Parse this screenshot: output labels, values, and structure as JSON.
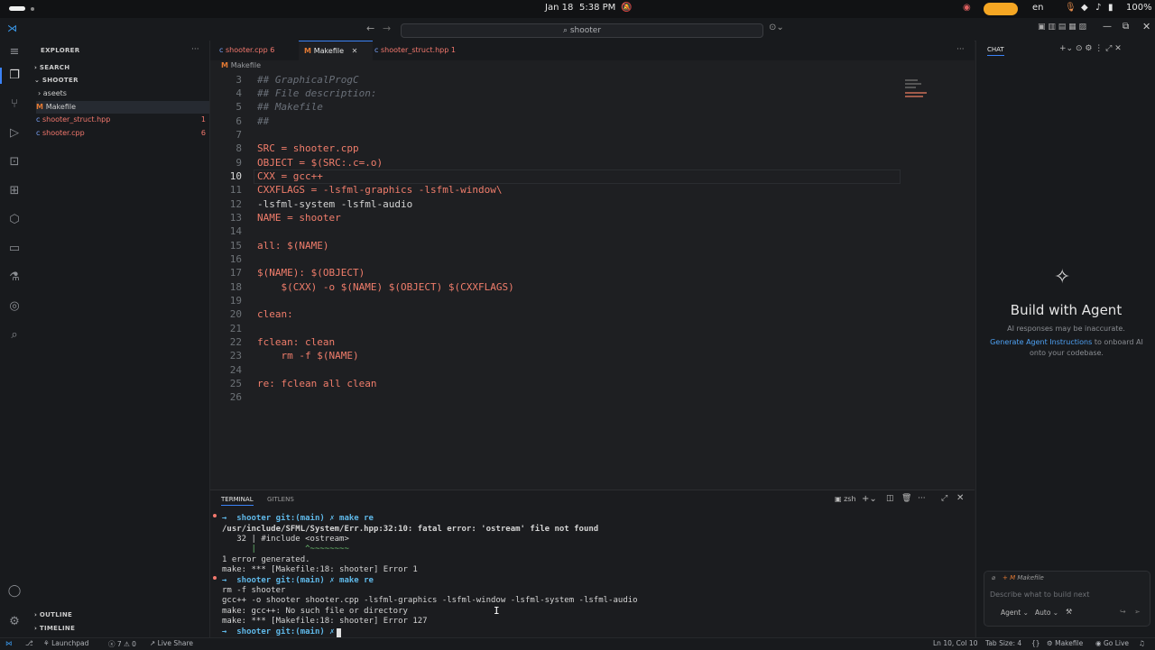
{
  "system": {
    "date": "Jan 18",
    "time": "5:38 PM",
    "lang": "en",
    "battery": "100%"
  },
  "window": {
    "search_text": "shooter"
  },
  "sidebar": {
    "title": "EXPLORER",
    "search_section": "SEARCH",
    "project": "SHOOTER",
    "items": [
      {
        "label": "aseets",
        "icon": "folder-chevron-icon"
      },
      {
        "label": "Makefile",
        "icon": "makefile-icon"
      },
      {
        "label": "shooter_struct.hpp",
        "badge": "1"
      },
      {
        "label": "shooter.cpp",
        "badge": "6"
      }
    ],
    "outline": "OUTLINE",
    "timeline": "TIMELINE"
  },
  "tabs": [
    {
      "label": "shooter.cpp",
      "badge": "6"
    },
    {
      "label": "Makefile"
    },
    {
      "label": "shooter_struct.hpp",
      "badge": "1"
    }
  ],
  "breadcrumb": "Makefile",
  "editor": {
    "line_numbers": [
      "3",
      "4",
      "5",
      "6",
      "7",
      "8",
      "9",
      "10",
      "11",
      "12",
      "13",
      "14",
      "15",
      "16",
      "17",
      "18",
      "19",
      "20",
      "21",
      "22",
      "23",
      "24",
      "25",
      "26"
    ],
    "lines": [
      "## GraphicalProgC",
      "## File description:",
      "## Makefile",
      "##",
      "",
      "SRC = shooter.cpp",
      "OBJECT = $(SRC:.c=.o)",
      "CXX = gcc++",
      "CXXFLAGS = -lsfml-graphics -lsfml-window\\",
      "-lsfml-system -lsfml-audio",
      "NAME = shooter",
      "",
      "all: $(NAME)",
      "",
      "$(NAME): $(OBJECT)",
      "    $(CXX) -o $(NAME) $(OBJECT) $(CXXFLAGS)",
      "",
      "clean:",
      "",
      "fclean: clean",
      "    rm -f $(NAME)",
      "",
      "re: fclean all clean",
      ""
    ]
  },
  "panel": {
    "tabs": [
      "TERMINAL",
      "GITLENS"
    ],
    "shell": "zsh",
    "lines": [
      "→  shooter git:(main) ✗ make re",
      "/usr/include/SFML/System/Err.hpp:32:10: fatal error: 'ostream' file not found",
      "   32 | #include <ostream>",
      "      |          ^~~~~~~~~",
      "1 error generated.",
      "make: *** [Makefile:18: shooter] Error 1",
      "→  shooter git:(main) ✗ make re",
      "rm -f shooter",
      "gcc++ -o shooter shooter.cpp -lsfml-graphics -lsfml-window -lsfml-system -lsfml-audio",
      "make: gcc++: No such file or directory",
      "make: *** [Makefile:18: shooter] Error 127",
      "→  shooter git:(main) ✗ "
    ]
  },
  "chat": {
    "header": "CHAT",
    "title": "Build with Agent",
    "disclaimer": "AI responses may be inaccurate.",
    "link": "Generate Agent Instructions",
    "instructions_rest": "to onboard AI onto your codebase.",
    "context_file": "Makefile",
    "input_placeholder": "Describe what to build next",
    "mode": "Agent",
    "model": "Auto"
  },
  "status": {
    "launchpad": "Launchpad",
    "problems": "7",
    "warnings": "0",
    "live_share": "Live Share",
    "cursor": "Ln 10, Col 10",
    "tab_size": "Tab Size: 4",
    "lang": "Makefile",
    "go_live": "Go Live"
  },
  "colors": {
    "accent": "#3b82f6",
    "error": "#f3786d",
    "variable": "#f07d6b"
  }
}
